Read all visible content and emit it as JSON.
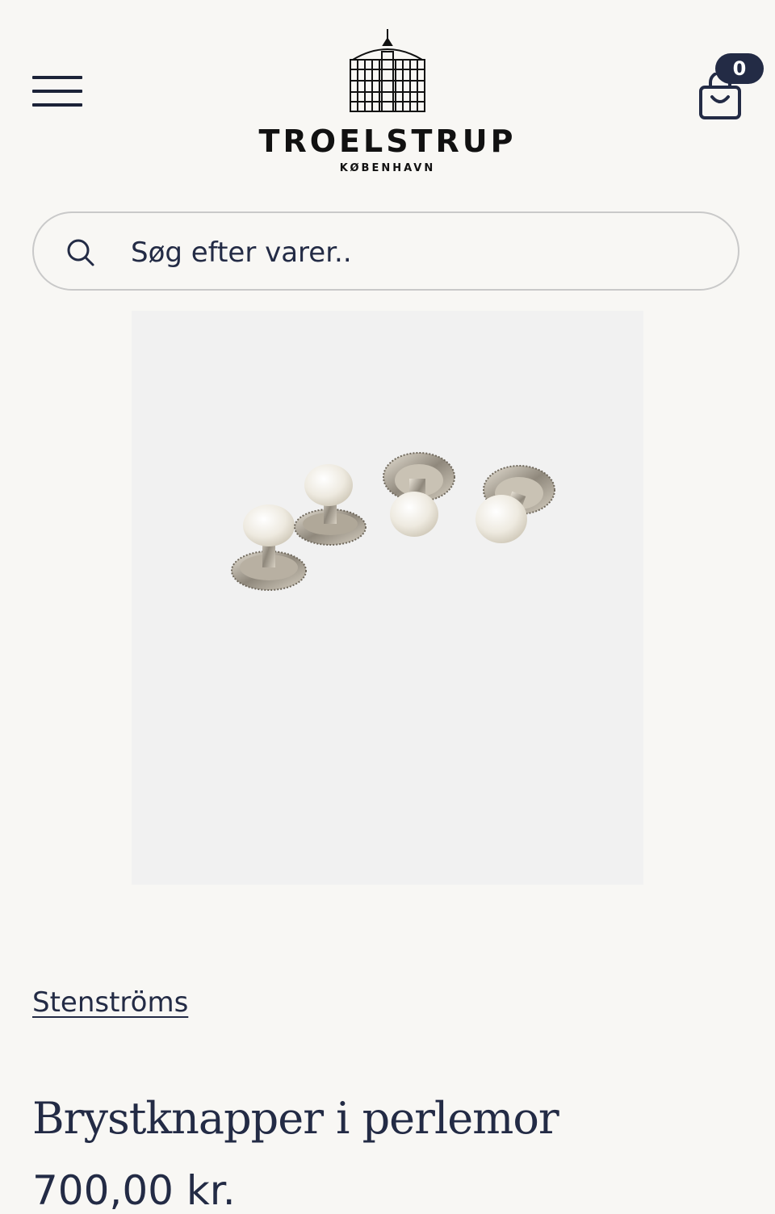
{
  "header": {
    "logo_name": "TROELSTRUP",
    "logo_subtitle": "KØBENHAVN",
    "cart_count": "0",
    "icons": {
      "menu": "hamburger-menu-icon",
      "cart": "shopping-bag-icon",
      "logo": "building-logo-icon"
    }
  },
  "search": {
    "placeholder": "Søg efter varer..",
    "icon": "search-icon"
  },
  "product": {
    "image_alt": "Brystknapper i perlemor",
    "brand": "Stenströms",
    "title": "Brystknapper i perlemor",
    "price": "700,00 kr."
  },
  "colors": {
    "background": "#f8f7f4",
    "text": "#232b45",
    "badge": "#232b45",
    "image_background": "#f1f1f1"
  }
}
